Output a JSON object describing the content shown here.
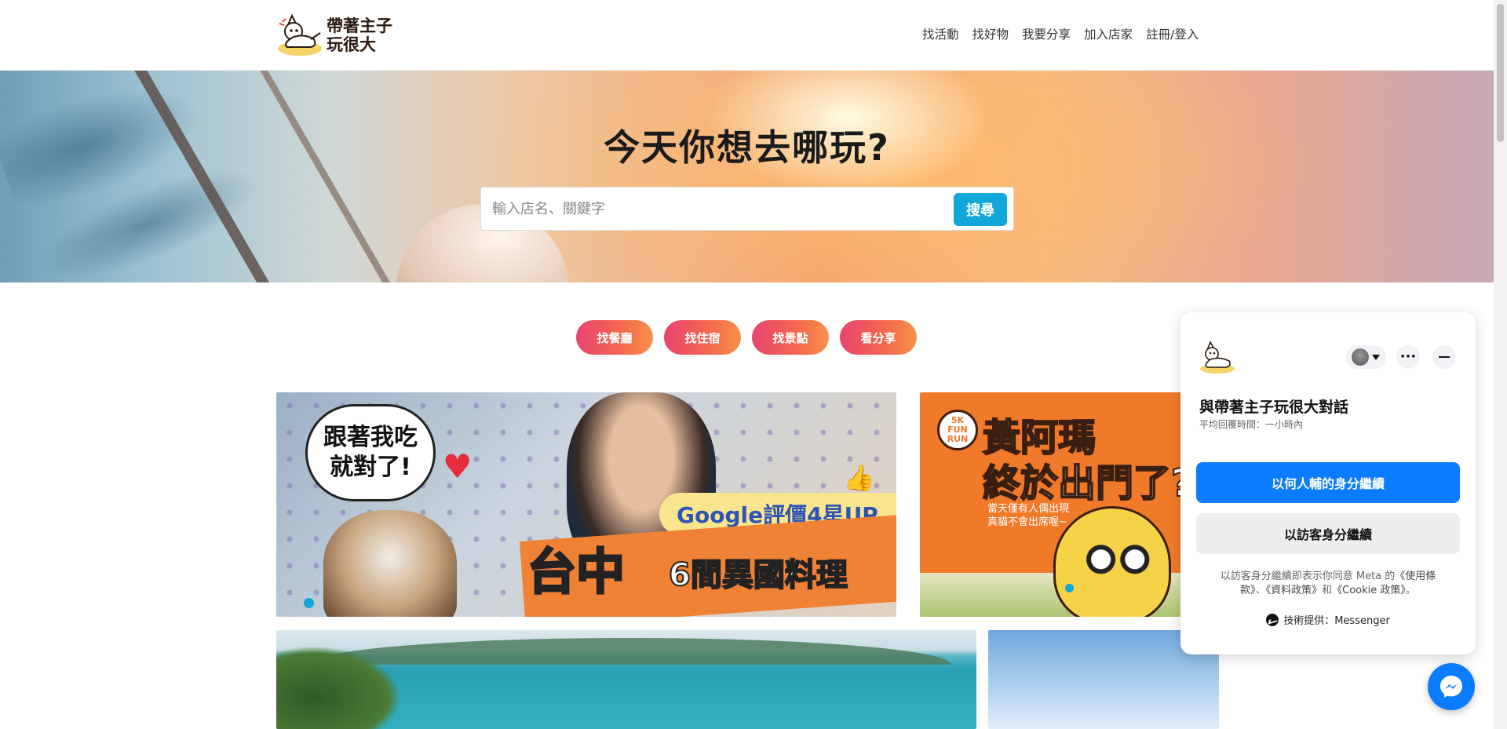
{
  "header": {
    "logo_text": "帶著主子玩很大",
    "nav": [
      "找活動",
      "找好物",
      "我要分享",
      "加入店家",
      "註冊/登入"
    ]
  },
  "hero": {
    "title": "今天你想去哪玩?",
    "search_placeholder": "輸入店名、關鍵字",
    "search_value": "",
    "search_button": "搜尋"
  },
  "categories": [
    "找餐廳",
    "找住宿",
    "找景點",
    "看分享"
  ],
  "carousel": {
    "card1": {
      "bubble": "跟著我吃\n就對了!",
      "google_text": "Google評價4星UP",
      "big_text": "台中",
      "sub_text": "6間異國料理"
    },
    "card2": {
      "badge": "5K\nFUN\nRUN",
      "title_line1": "黃阿瑪",
      "title_line2": "終於出門了?!",
      "note": "當天僅有人偶出現\n真貓不會出席喔~"
    }
  },
  "chat": {
    "title": "與帶著主子玩很大對話",
    "subtitle": "平均回覆時間：一小時內",
    "primary_button": "以何人輔的身分繼續",
    "secondary_button": "以訪客身分繼續",
    "legal_prefix": "以訪客身分繼續即表示你同意 Meta 的",
    "legal_terms": "《使用條款》",
    "legal_sep1": "、",
    "legal_data": "《資料政策》",
    "legal_and": "和",
    "legal_cookie": "《Cookie 政策》",
    "legal_end": "。",
    "powered_by": "技術提供：Messenger"
  },
  "colors": {
    "accent_blue": "#11a7d8",
    "messenger_blue": "#0a7cff",
    "pill_gradient_start": "#e9436f",
    "pill_gradient_end": "#f8914a"
  }
}
